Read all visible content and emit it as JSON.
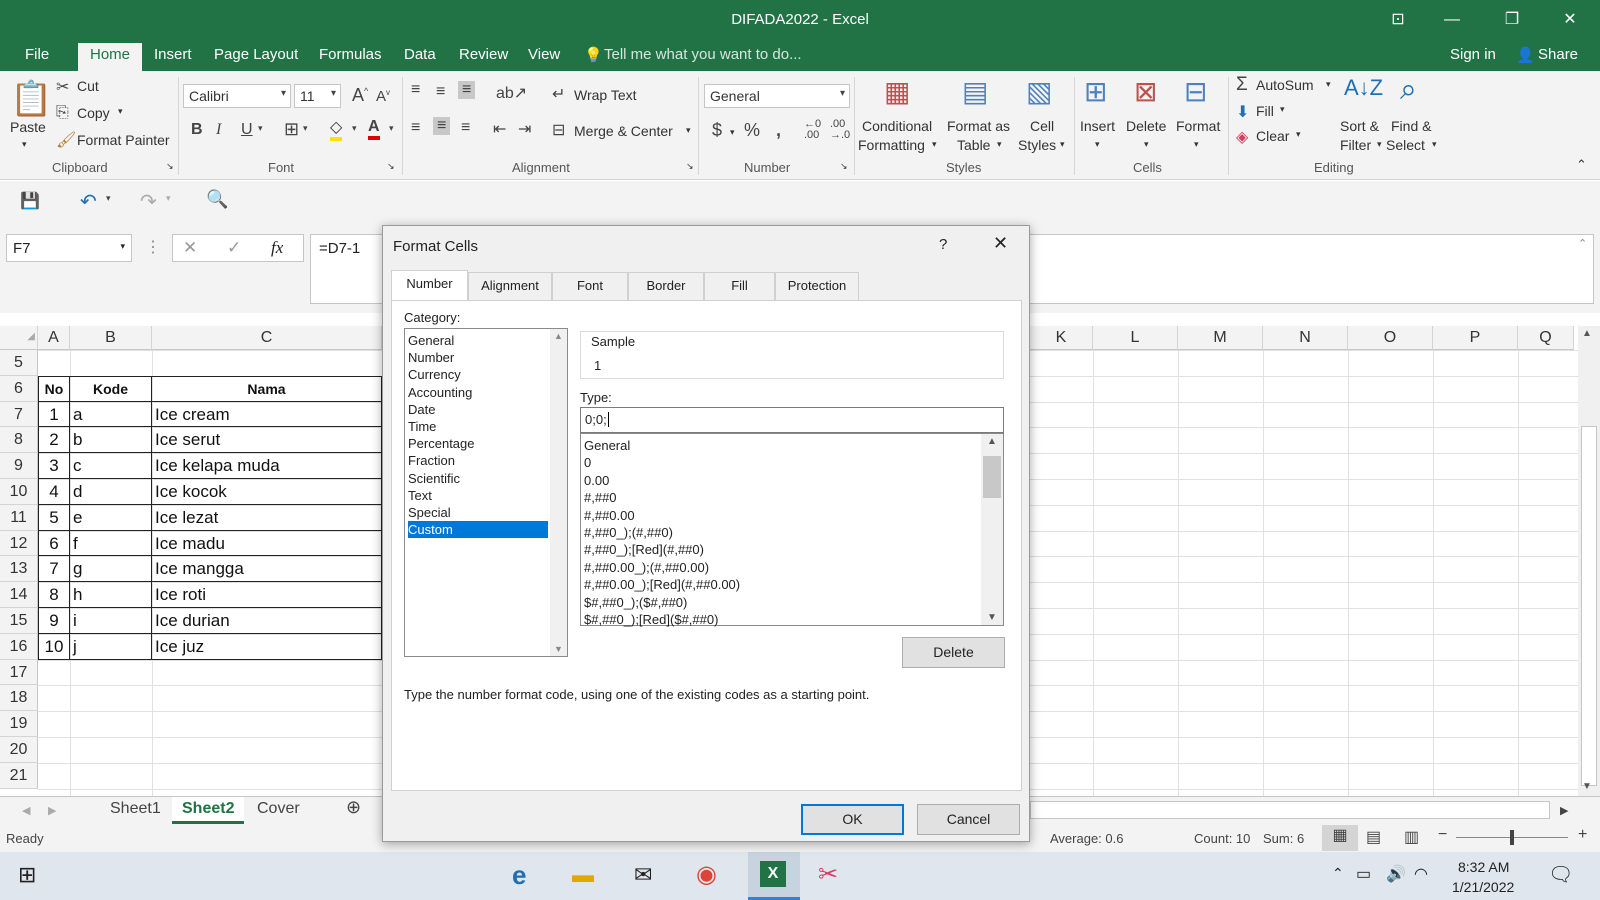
{
  "window": {
    "title": "DIFADA2022 - Excel"
  },
  "tabs": [
    "File",
    "Home",
    "Insert",
    "Page Layout",
    "Formulas",
    "Data",
    "Review",
    "View"
  ],
  "tell_me": "Tell me what you want to do...",
  "account": {
    "signin": "Sign in",
    "share": "Share"
  },
  "ribbon": {
    "clipboard": {
      "paste": "Paste",
      "cut": "Cut",
      "copy": "Copy",
      "format_painter": "Format Painter",
      "group": "Clipboard"
    },
    "font": {
      "name": "Calibri",
      "size": "11",
      "group": "Font"
    },
    "alignment": {
      "wrap": "Wrap Text",
      "merge": "Merge & Center",
      "group": "Alignment"
    },
    "number": {
      "format": "General",
      "group": "Number"
    },
    "styles": {
      "conditional_1": "Conditional",
      "conditional_2": "Formatting",
      "format_table_1": "Format as",
      "format_table_2": "Table",
      "cell_styles_1": "Cell",
      "cell_styles_2": "Styles",
      "group": "Styles"
    },
    "cells": {
      "insert": "Insert",
      "delete": "Delete",
      "format": "Format",
      "group": "Cells"
    },
    "editing": {
      "autosum": "AutoSum",
      "fill": "Fill",
      "clear": "Clear",
      "sort_1": "Sort &",
      "sort_2": "Filter",
      "find_1": "Find &",
      "find_2": "Select",
      "group": "Editing"
    }
  },
  "formula_bar": {
    "name_box": "F7",
    "formula": "=D7-1"
  },
  "columns_left": [
    "A",
    "B",
    "C"
  ],
  "columns_right": [
    "K",
    "L",
    "M",
    "N",
    "O",
    "P",
    "Q"
  ],
  "rows": [
    "5",
    "6",
    "7",
    "8",
    "9",
    "10",
    "11",
    "12",
    "13",
    "14",
    "15",
    "16",
    "17",
    "18",
    "19",
    "20",
    "21"
  ],
  "table": {
    "headers": {
      "no": "No",
      "kode": "Kode",
      "nama": "Nama"
    },
    "data": [
      {
        "no": "1",
        "kode": "a",
        "nama": "Ice cream"
      },
      {
        "no": "2",
        "kode": "b",
        "nama": "Ice serut"
      },
      {
        "no": "3",
        "kode": "c",
        "nama": "Ice kelapa muda"
      },
      {
        "no": "4",
        "kode": "d",
        "nama": "Ice kocok"
      },
      {
        "no": "5",
        "kode": "e",
        "nama": "Ice lezat"
      },
      {
        "no": "6",
        "kode": "f",
        "nama": "Ice madu"
      },
      {
        "no": "7",
        "kode": "g",
        "nama": "Ice mangga"
      },
      {
        "no": "8",
        "kode": "h",
        "nama": "Ice roti"
      },
      {
        "no": "9",
        "kode": "i",
        "nama": "Ice durian"
      },
      {
        "no": "10",
        "kode": "j",
        "nama": "Ice juz"
      }
    ]
  },
  "sheets": [
    "Sheet1",
    "Sheet2",
    "Cover"
  ],
  "active_sheet": "Sheet2",
  "status": {
    "ready": "Ready",
    "average": "Average: 0.6",
    "count": "Count: 10",
    "sum": "Sum: 6"
  },
  "dialog": {
    "title": "Format Cells",
    "help": "?",
    "tabs": [
      "Number",
      "Alignment",
      "Font",
      "Border",
      "Fill",
      "Protection"
    ],
    "category_label": "Category:",
    "categories": [
      "General",
      "Number",
      "Currency",
      "Accounting",
      "Date",
      "Time",
      "Percentage",
      "Fraction",
      "Scientific",
      "Text",
      "Special",
      "Custom"
    ],
    "selected_category": "Custom",
    "sample_label": "Sample",
    "sample_value": "1",
    "type_label": "Type:",
    "type_value": "0;0;",
    "formats": [
      "General",
      "0",
      "0.00",
      "#,##0",
      "#,##0.00",
      "#,##0_);(#,##0)",
      "#,##0_);[Red](#,##0)",
      "#,##0.00_);(#,##0.00)",
      "#,##0.00_);[Red](#,##0.00)",
      "$#,##0_);($#,##0)",
      "$#,##0_);[Red]($#,##0)"
    ],
    "delete": "Delete",
    "hint": "Type the number format code, using one of the existing codes as a starting point.",
    "ok": "OK",
    "cancel": "Cancel"
  },
  "taskbar": {
    "time": "8:32 AM",
    "date": "1/21/2022"
  }
}
